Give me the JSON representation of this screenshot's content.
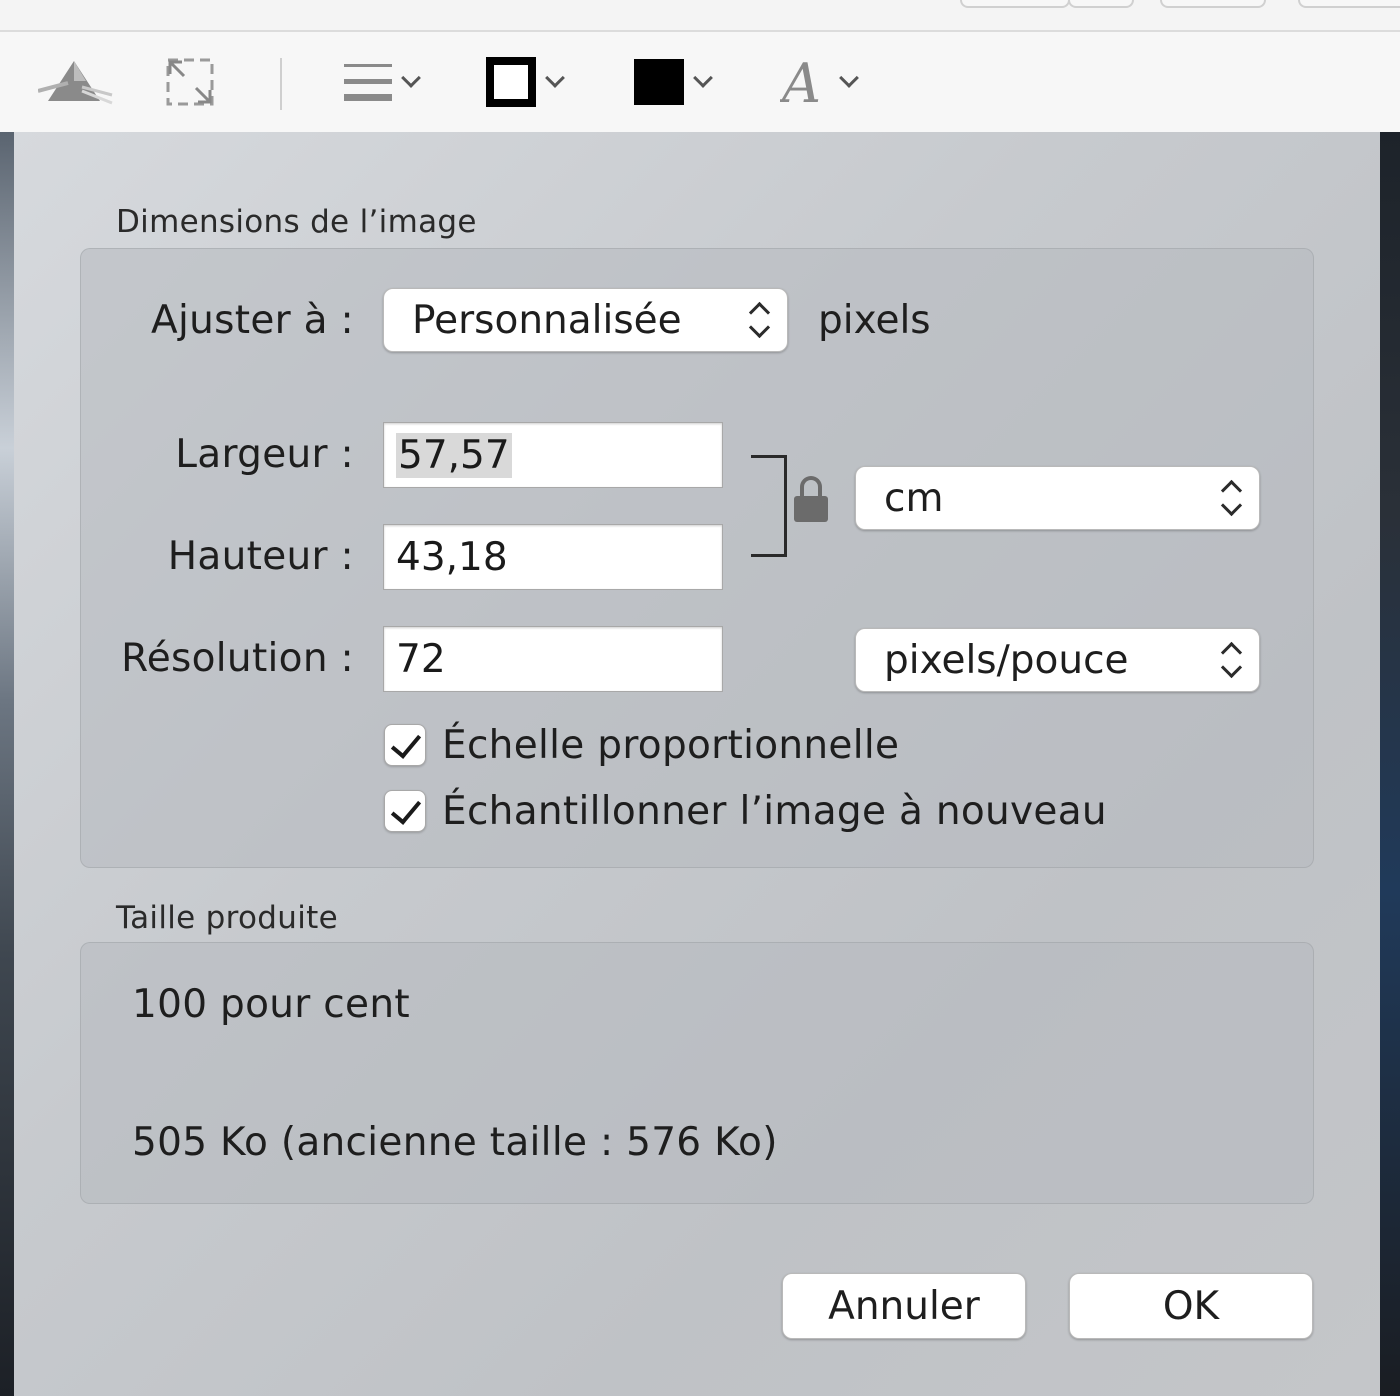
{
  "toolbar": {
    "items": [
      {
        "icon": "adjust-color-icon"
      },
      {
        "icon": "adjust-size-icon"
      },
      {
        "icon": "line-style-icon"
      },
      {
        "icon": "border-color-icon"
      },
      {
        "icon": "fill-color-icon"
      },
      {
        "icon": "text-style-icon"
      }
    ]
  },
  "dialog": {
    "dimensions_title": "Dimensions de l’image",
    "fit_label": "Ajuster à :",
    "fit_value": "Personnalisée",
    "fit_unit": "pixels",
    "width_label": "Largeur :",
    "width_value": "57,57",
    "height_label": "Hauteur :",
    "height_value": "43,18",
    "size_unit": "cm",
    "resolution_label": "Résolution :",
    "resolution_value": "72",
    "resolution_unit": "pixels/pouce",
    "scale_proportionally": "Échelle proportionnelle",
    "resample": "Échantillonner l’image à nouveau",
    "result_title": "Taille produite",
    "result_percent": "100 pour cent",
    "result_size": "505 Ko (ancienne taille : 576 Ko)",
    "cancel_label": "Annuler",
    "ok_label": "OK"
  }
}
